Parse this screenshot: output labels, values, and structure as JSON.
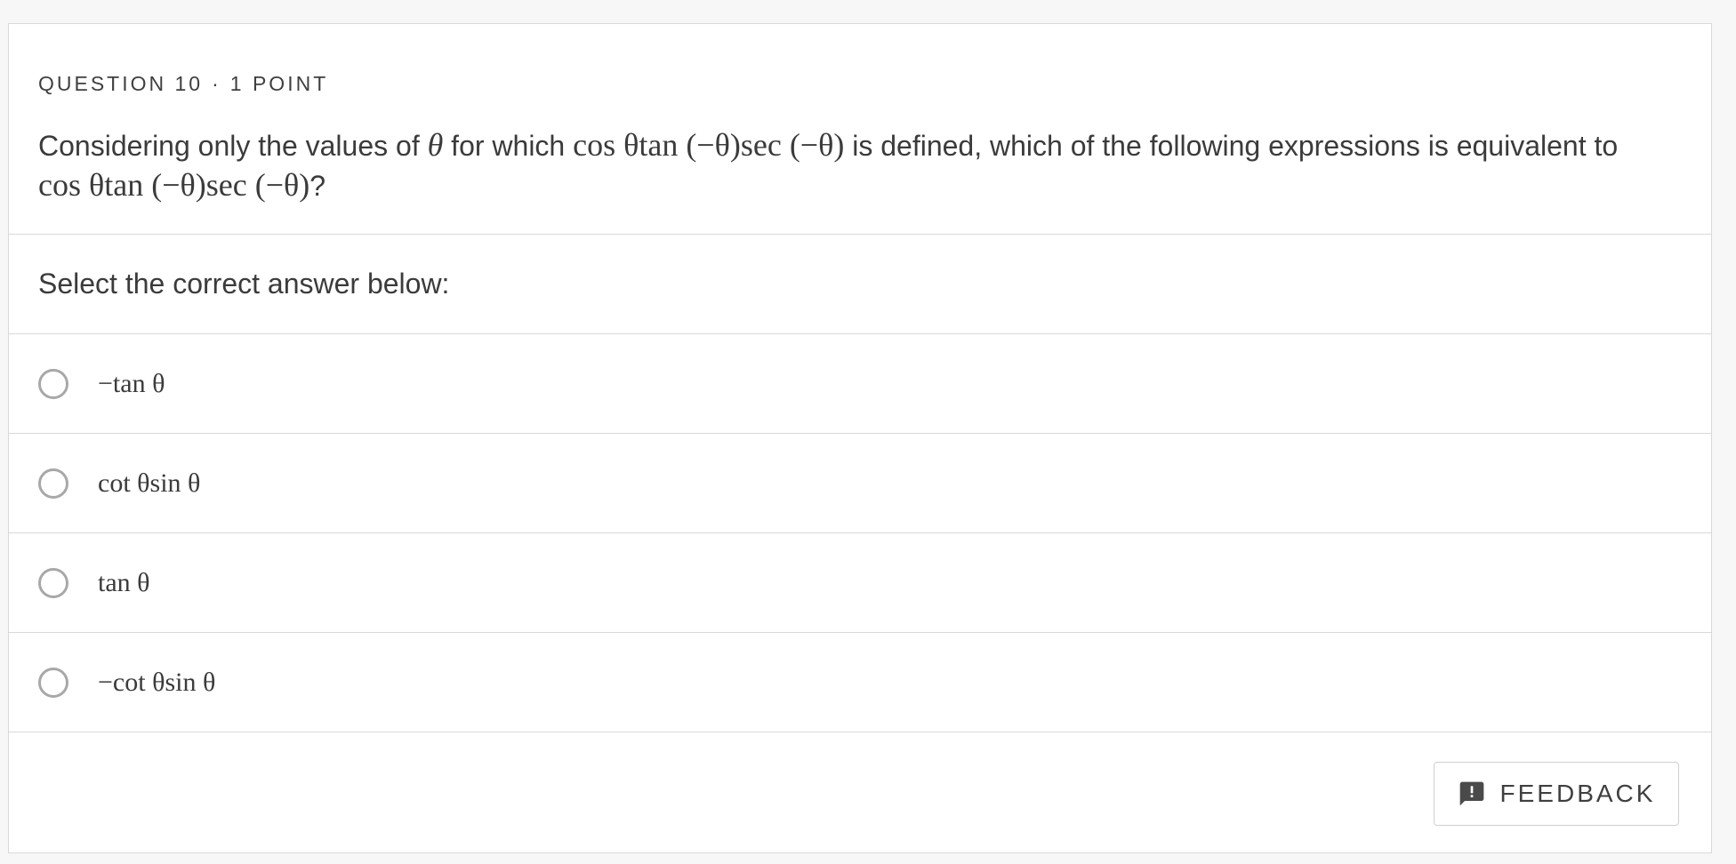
{
  "question": {
    "number_label": "QUESTION 10",
    "separator": "·",
    "points_label": "1 POINT",
    "text_part1": "Considering only the values of ",
    "theta": "θ",
    "text_part2": " for which ",
    "expression": "cos θtan (−θ)sec (−θ)",
    "text_part3": " is defined, which of the following expressions is equivalent to ",
    "text_part4": "?"
  },
  "prompt": "Select the correct answer below:",
  "options": [
    {
      "label": "−tan θ"
    },
    {
      "label": "cot θsin θ"
    },
    {
      "label": "tan θ"
    },
    {
      "label": "−cot θsin θ"
    }
  ],
  "feedback": {
    "label": "FEEDBACK",
    "icon": "feedback-icon"
  },
  "colors": {
    "text": "#3b3b3b",
    "border": "#d9d9d9",
    "radio_border": "#a8a8a8",
    "background": "#f7f7f7"
  }
}
